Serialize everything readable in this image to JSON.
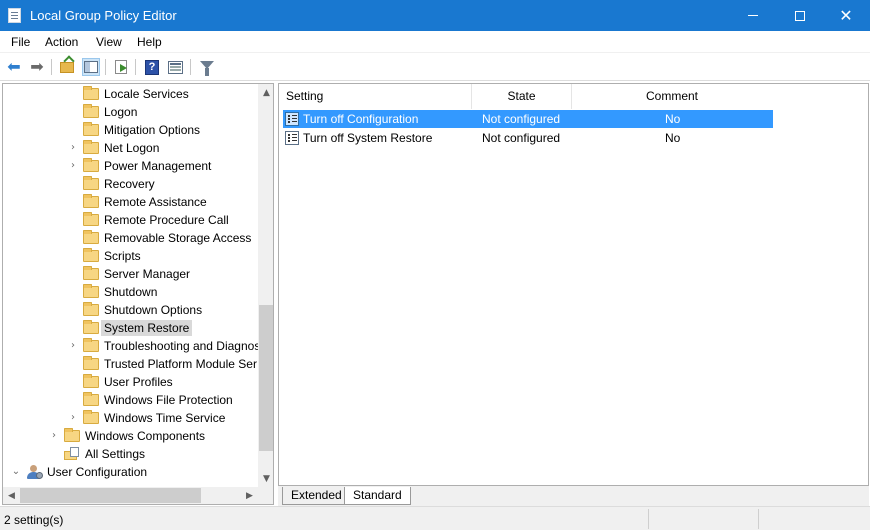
{
  "window": {
    "title": "Local Group Policy Editor",
    "accent": "#1978d0"
  },
  "menu": {
    "items": [
      {
        "label": "File"
      },
      {
        "label": "Action"
      },
      {
        "label": "View"
      },
      {
        "label": "Help"
      }
    ]
  },
  "toolbar": {
    "buttons": [
      {
        "icon": "back-arrow-icon"
      },
      {
        "icon": "forward-arrow-icon"
      },
      {
        "icon": "up-folder-icon"
      },
      {
        "icon": "show-hide-tree-icon",
        "pressed": true
      },
      {
        "icon": "export-list-icon"
      },
      {
        "icon": "help-icon",
        "glyph": "?"
      },
      {
        "icon": "properties-icon"
      },
      {
        "icon": "filter-icon"
      }
    ]
  },
  "tree": {
    "items": [
      {
        "label": "Locale Services",
        "expander": "",
        "icon": "folder"
      },
      {
        "label": "Logon",
        "expander": "",
        "icon": "folder"
      },
      {
        "label": "Mitigation Options",
        "expander": "",
        "icon": "folder"
      },
      {
        "label": "Net Logon",
        "expander": ">",
        "icon": "folder"
      },
      {
        "label": "Power Management",
        "expander": ">",
        "icon": "folder"
      },
      {
        "label": "Recovery",
        "expander": "",
        "icon": "folder"
      },
      {
        "label": "Remote Assistance",
        "expander": "",
        "icon": "folder"
      },
      {
        "label": "Remote Procedure Call",
        "expander": "",
        "icon": "folder"
      },
      {
        "label": "Removable Storage Access",
        "expander": "",
        "icon": "folder"
      },
      {
        "label": "Scripts",
        "expander": "",
        "icon": "folder"
      },
      {
        "label": "Server Manager",
        "expander": "",
        "icon": "folder"
      },
      {
        "label": "Shutdown",
        "expander": "",
        "icon": "folder"
      },
      {
        "label": "Shutdown Options",
        "expander": "",
        "icon": "folder"
      },
      {
        "label": "System Restore",
        "expander": "",
        "icon": "folder",
        "selected": true
      },
      {
        "label": "Troubleshooting and Diagnos",
        "expander": ">",
        "icon": "folder"
      },
      {
        "label": "Trusted Platform Module Ser",
        "expander": "",
        "icon": "folder"
      },
      {
        "label": "User Profiles",
        "expander": "",
        "icon": "folder"
      },
      {
        "label": "Windows File Protection",
        "expander": "",
        "icon": "folder"
      },
      {
        "label": "Windows Time Service",
        "expander": ">",
        "icon": "folder"
      },
      {
        "label": "Windows Components",
        "expander": ">",
        "icon": "folder",
        "level": "parent"
      },
      {
        "label": "All Settings",
        "expander": "",
        "icon": "settings",
        "level": "parent"
      },
      {
        "label": "User Configuration",
        "expander": "v",
        "icon": "user",
        "level": "root"
      }
    ]
  },
  "list": {
    "columns": {
      "setting": "Setting",
      "state": "State",
      "comment": "Comment"
    },
    "rows": [
      {
        "setting": "Turn off Configuration",
        "state": "Not configured",
        "comment": "No",
        "selected": true
      },
      {
        "setting": "Turn off System Restore",
        "state": "Not configured",
        "comment": "No",
        "selected": false
      }
    ],
    "selection_color": "#3399ff"
  },
  "tabs": [
    {
      "label": "Extended"
    },
    {
      "label": "Standard",
      "active": true
    }
  ],
  "status": {
    "text": "2 setting(s)"
  }
}
